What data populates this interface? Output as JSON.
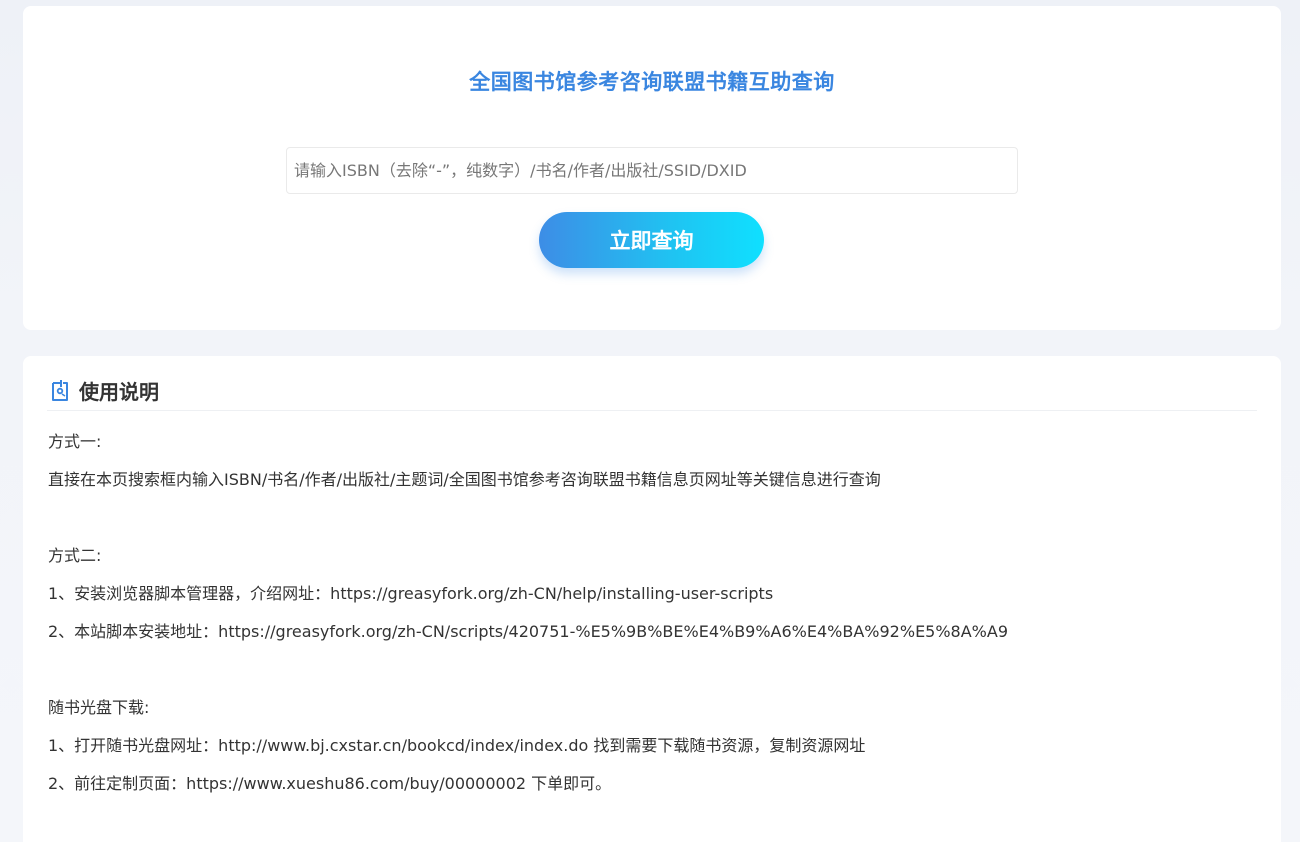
{
  "search": {
    "title": "全国图书馆参考咨询联盟书籍互助查询",
    "placeholder": "请输入ISBN（去除“-”，纯数字）/书名/作者/出版社/SSID/DXID",
    "button_label": "立即查询"
  },
  "instructions": {
    "icon": "document-tag-icon",
    "accent_color": "#3a86e0",
    "title": "使用说明",
    "method1_heading": "方式一:",
    "method1_text": "直接在本页搜索框内输入ISBN/书名/作者/出版社/主题词/全国图书馆参考咨询联盟书籍信息页网址等关键信息进行查询",
    "method2_heading": "方式二:",
    "method2_step1": "1、安装浏览器脚本管理器，介绍网址：https://greasyfork.org/zh-CN/help/installing-user-scripts",
    "method2_step2": "2、本站脚本安装地址：https://greasyfork.org/zh-CN/scripts/420751-%E5%9B%BE%E4%B9%A6%E4%BA%92%E5%8A%A9",
    "cd_heading": "随书光盘下载:",
    "cd_step1": "1、打开随书光盘网址：http://www.bj.cxstar.cn/bookcd/index/index.do 找到需要下载随书资源，复制资源网址",
    "cd_step2": "2、前往定制页面：https://www.xueshu86.com/buy/00000002 下单即可。"
  }
}
